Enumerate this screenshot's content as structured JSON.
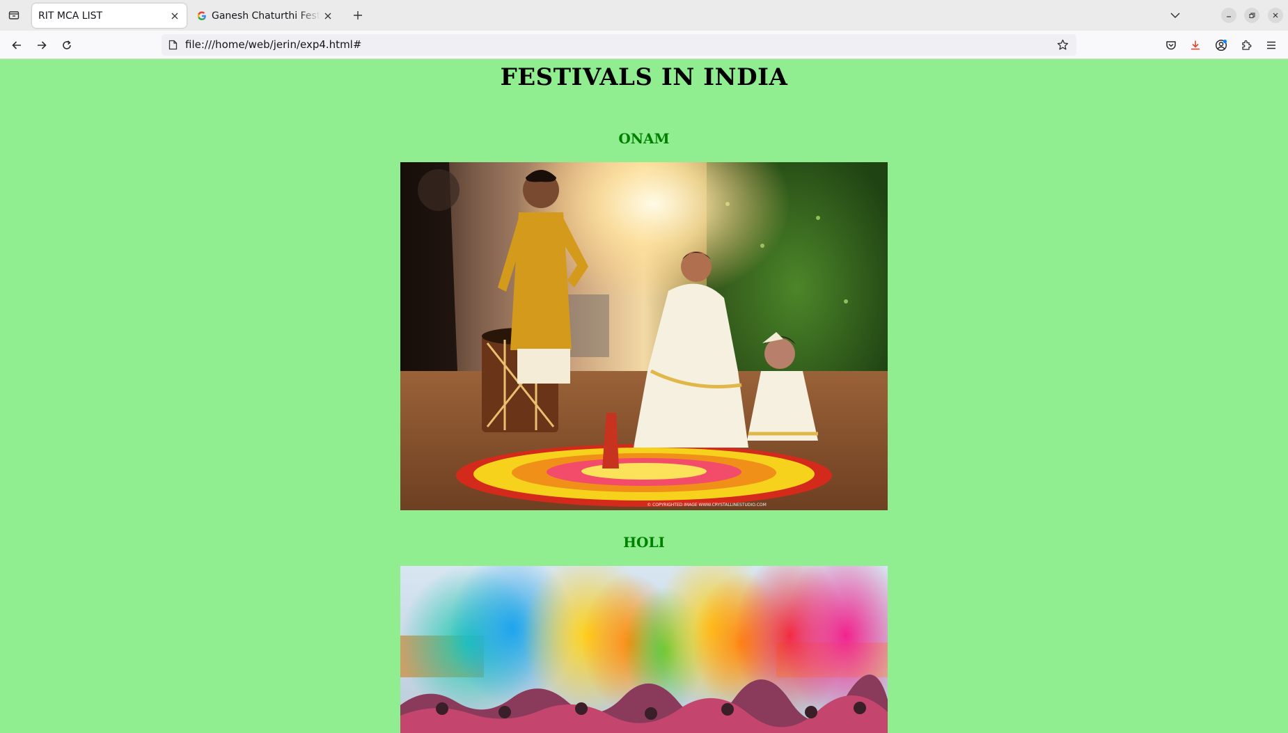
{
  "browser": {
    "tabs": [
      {
        "title": "RIT MCA LIST",
        "active": true
      },
      {
        "title": "Ganesh Chaturthi Festiva",
        "active": false
      }
    ],
    "url": "file:///home/web/jerin/exp4.html#",
    "icons": {
      "list_all_tabs": "tab-list-icon",
      "back": "arrow-left-icon",
      "forward": "arrow-right-icon",
      "reload": "reload-icon",
      "bookmark": "star-icon",
      "pocket": "pocket-icon",
      "downloads": "download-icon",
      "account": "account-icon",
      "extensions": "puzzle-icon",
      "menu": "hamburger-menu-icon"
    }
  },
  "page": {
    "title": "FESTIVALS IN INDIA",
    "background_color": "#90ee90",
    "heading_color": "#008000",
    "festivals": [
      {
        "name": "ONAM",
        "image_watermark": "© COPYRIGHTED IMAGE  WWW.CRYSTALLINESTUDIO.COM"
      },
      {
        "name": "HOLI"
      }
    ]
  }
}
